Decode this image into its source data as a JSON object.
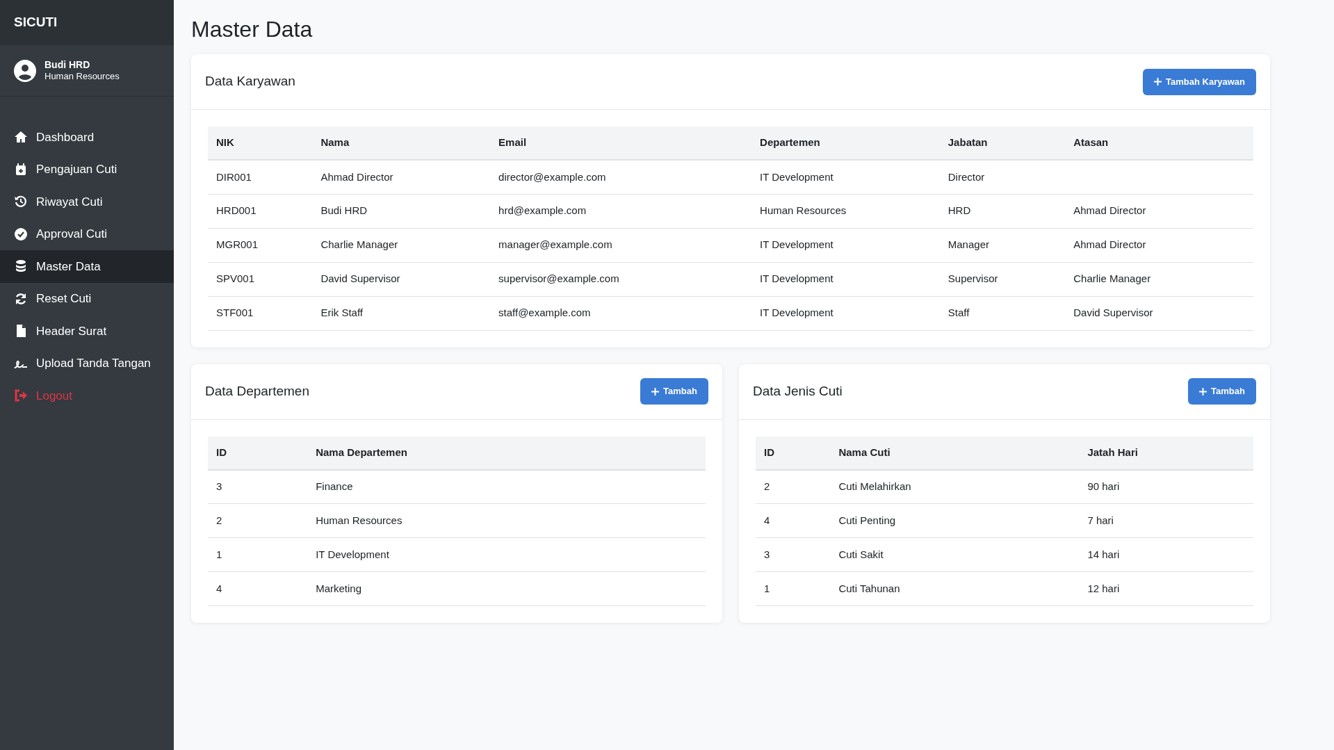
{
  "sidebar": {
    "brand": "SICUTI",
    "user": {
      "name": "Budi HRD",
      "department": "Human Resources"
    },
    "items": [
      {
        "label": "Dashboard",
        "selected": false,
        "kind": "link"
      },
      {
        "label": "Pengajuan Cuti",
        "selected": false,
        "kind": "link"
      },
      {
        "label": "Riwayat Cuti",
        "selected": false,
        "kind": "link"
      },
      {
        "label": "Approval Cuti",
        "selected": false,
        "kind": "link"
      },
      {
        "label": "Master Data",
        "selected": true,
        "kind": "link"
      },
      {
        "label": "Reset Cuti",
        "selected": false,
        "kind": "link"
      },
      {
        "label": "Header Surat",
        "selected": false,
        "kind": "link"
      },
      {
        "label": "Upload Tanda Tangan",
        "selected": false,
        "kind": "link"
      },
      {
        "label": "Logout",
        "selected": false,
        "kind": "danger"
      }
    ]
  },
  "page_title": "Master Data",
  "cards": [
    {
      "title": "Data Karyawan",
      "button": "Tambah Karyawan",
      "columns": [
        "NIK",
        "Nama",
        "Email",
        "Departemen",
        "Jabatan",
        "Atasan"
      ],
      "rows": [
        [
          "DIR001",
          "Ahmad Director",
          "director@example.com",
          "IT Development",
          "Director",
          ""
        ],
        [
          "HRD001",
          "Budi HRD",
          "hrd@example.com",
          "Human Resources",
          "HRD",
          "Ahmad Director"
        ],
        [
          "MGR001",
          "Charlie Manager",
          "manager@example.com",
          "IT Development",
          "Manager",
          "Ahmad Director"
        ],
        [
          "SPV001",
          "David Supervisor",
          "supervisor@example.com",
          "IT Development",
          "Supervisor",
          "Charlie Manager"
        ],
        [
          "STF001",
          "Erik Staff",
          "staff@example.com",
          "IT Development",
          "Staff",
          "David Supervisor"
        ]
      ]
    },
    {
      "title": "Data Departemen",
      "button": "Tambah",
      "columns": [
        "ID",
        "Nama Departemen"
      ],
      "rows": [
        [
          "3",
          "Finance"
        ],
        [
          "2",
          "Human Resources"
        ],
        [
          "1",
          "IT Development"
        ],
        [
          "4",
          "Marketing"
        ]
      ]
    },
    {
      "title": "Data Jenis Cuti",
      "button": "Tambah",
      "columns": [
        "ID",
        "Nama Cuti",
        "Jatah Hari"
      ],
      "rows": [
        [
          "2",
          "Cuti Melahirkan",
          "90 hari"
        ],
        [
          "4",
          "Cuti Penting",
          "7 hari"
        ],
        [
          "3",
          "Cuti Sakit",
          "14 hari"
        ],
        [
          "1",
          "Cuti Tahunan",
          "12 hari"
        ]
      ]
    }
  ]
}
